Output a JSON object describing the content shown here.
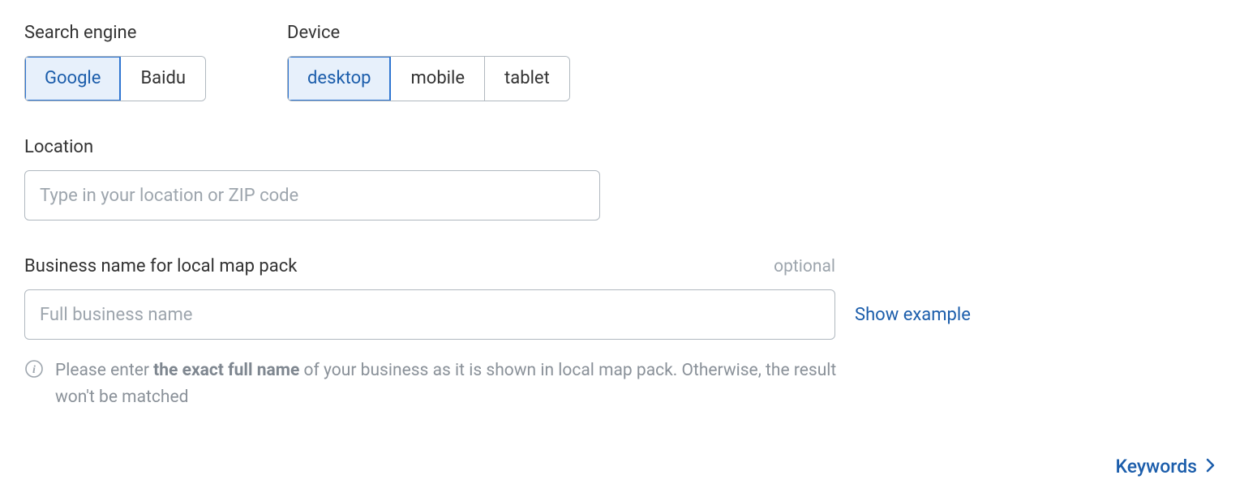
{
  "search_engine": {
    "label": "Search engine",
    "options": [
      "Google",
      "Baidu"
    ],
    "selected_index": 0
  },
  "device": {
    "label": "Device",
    "options": [
      "desktop",
      "mobile",
      "tablet"
    ],
    "selected_index": 0
  },
  "location": {
    "label": "Location",
    "placeholder": "Type in your location or ZIP code",
    "value": ""
  },
  "business": {
    "label": "Business name for local map pack",
    "optional_tag": "optional",
    "placeholder": "Full business name",
    "value": "",
    "show_example": "Show example",
    "hint_prefix": "Please enter ",
    "hint_bold": "the exact full name",
    "hint_suffix": " of your business as it is shown in local map pack. Otherwise, the result won't be matched"
  },
  "footer": {
    "keywords_link": "Keywords"
  }
}
